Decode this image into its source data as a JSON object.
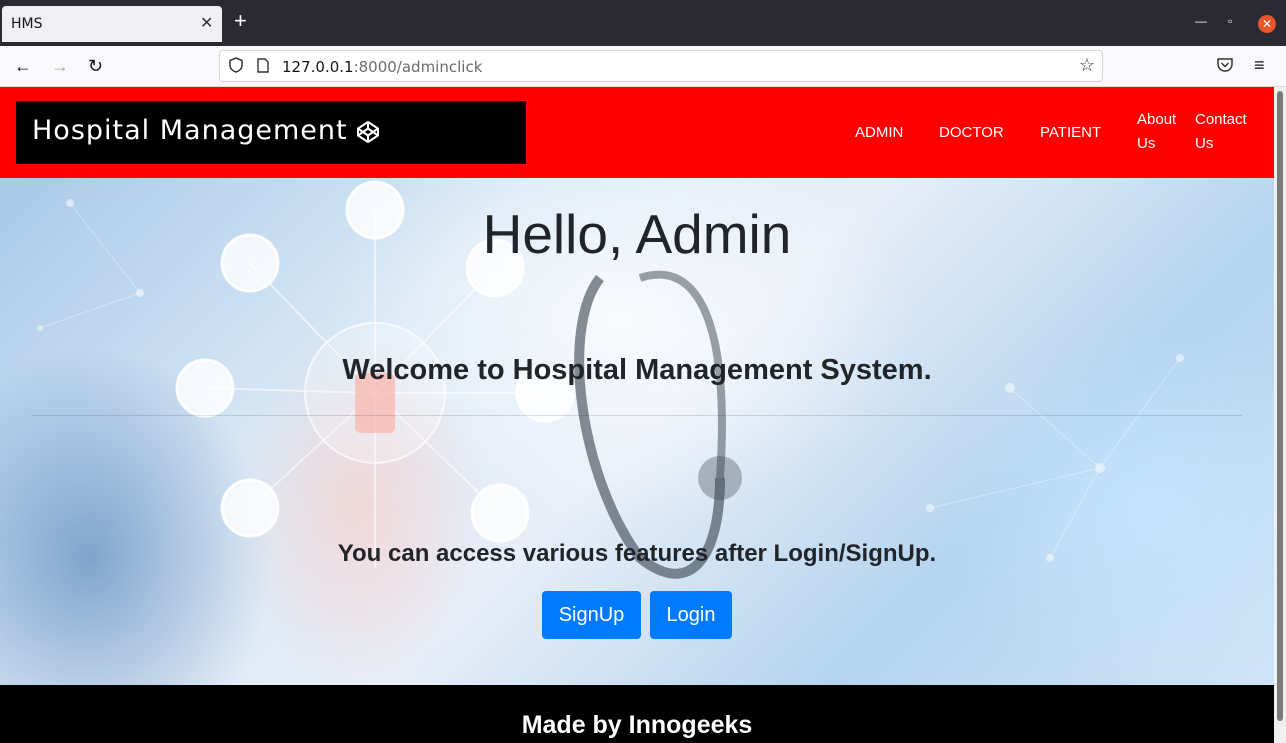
{
  "browser": {
    "tab_title": "HMS",
    "tab_close": "✕",
    "new_tab": "+",
    "url_host": "127.0.0.1",
    "url_rest": ":8000/adminclick",
    "minimize": "—",
    "restore": "▫",
    "close": "✕"
  },
  "header": {
    "brand": "Hospital Management",
    "menu": [
      {
        "label": "ADMIN"
      },
      {
        "label": "DOCTOR"
      },
      {
        "label": "PATIENT"
      },
      {
        "label_line1": "About",
        "label_line2": "Us"
      },
      {
        "label_line1": "Contact",
        "label_line2": "Us"
      }
    ],
    "color": "#ff0000"
  },
  "hero": {
    "title": "Hello, Admin",
    "lead": "Welcome to Hospital Management System.",
    "sub": "You can access various features after Login/SignUp.",
    "signup_label": "SignUp",
    "login_label": "Login",
    "button_color": "#007bff"
  },
  "footer": {
    "text": "Made by Innogeeks"
  }
}
